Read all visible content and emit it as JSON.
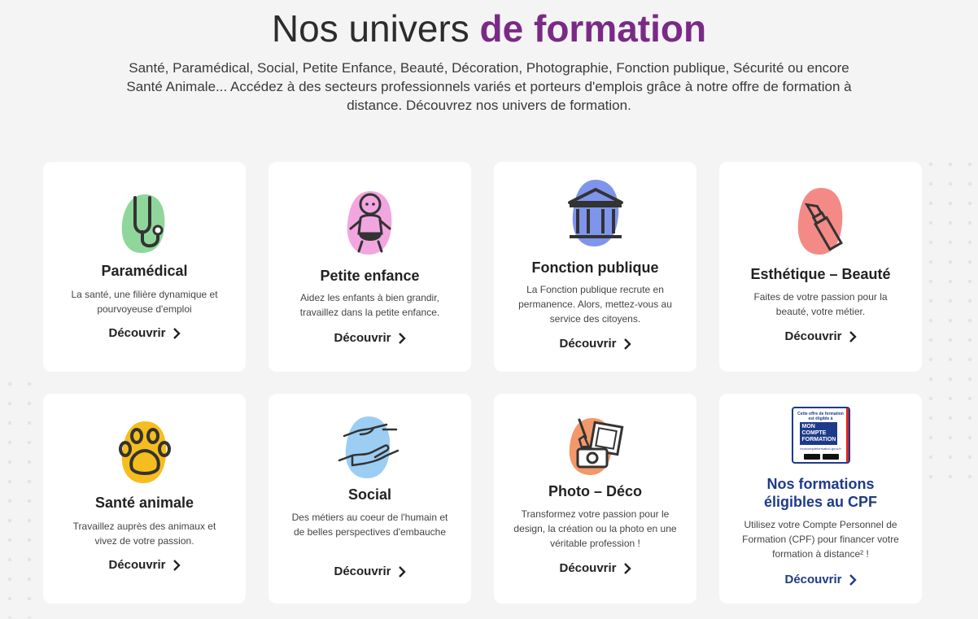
{
  "header": {
    "title_plain": "Nos univers ",
    "title_accent": "de formation",
    "subtitle": "Santé, Paramédical, Social, Petite Enfance, Beauté, Décoration, Photographie, Fonction publique, Sécurité ou encore Santé Animale... Accédez à des secteurs professionnels variés et porteurs d'emplois grâce à notre offre de formation à distance. Découvrez nos univers de formation."
  },
  "colors": {
    "accent": "#7a2a86",
    "cpf_blue": "#1e3a8a",
    "paramedical_blob": "#8fd69a",
    "petite_enfance_blob": "#f2a6e0",
    "fonction_publique_blob": "#7f95ec",
    "esthetique_blob": "#f48a86",
    "sante_animale_blob": "#f6bd1e",
    "social_blob": "#9ccdf3",
    "photo_blob": "#f2986a"
  },
  "cards": [
    {
      "icon": "stethoscope-icon",
      "title": "Paramédical",
      "desc": "La santé, une filière dynamique et pourvoyeuse d'emploi",
      "link": "Découvrir"
    },
    {
      "icon": "baby-icon",
      "title": "Petite enfance",
      "desc": "Aidez les enfants à bien grandir, travaillez dans la petite enfance.",
      "link": "Découvrir"
    },
    {
      "icon": "government-building-icon",
      "title": "Fonction publique",
      "desc": "La Fonction publique recrute en permanence. Alors, mettez-vous au service des citoyens.",
      "link": "Découvrir"
    },
    {
      "icon": "lipstick-icon",
      "title": "Esthétique – Beauté",
      "desc": "Faites de votre passion pour la beauté, votre métier.",
      "link": "Découvrir"
    },
    {
      "icon": "paw-icon",
      "title": "Santé animale",
      "desc": "Travaillez auprès des animaux et vivez de votre passion.",
      "link": "Découvrir"
    },
    {
      "icon": "helping-hands-icon",
      "title": "Social",
      "desc": "Des métiers au coeur de l'humain et de belles perspectives d'embauche",
      "link": "Découvrir"
    },
    {
      "icon": "camera-paint-icon",
      "title": "Photo – Déco",
      "desc": "Transformez votre passion pour le design, la création ou la photo en une véritable profession !",
      "link": "Découvrir"
    },
    {
      "icon": "mon-compte-formation-logo",
      "title": "Nos formations éligibles au CPF",
      "desc": "Utilisez votre Compte Personnel de Formation (CPF) pour financer votre formation à distance² !",
      "link": "Découvrir"
    }
  ],
  "cpf_logo": {
    "top_text": "Cette offre de formation est éligible à",
    "brand": "MON COMPTE FORMATION",
    "url": "moncompteformation.gouv.fr"
  }
}
